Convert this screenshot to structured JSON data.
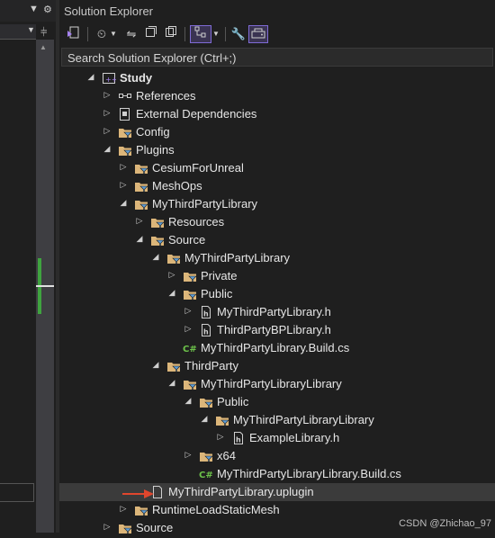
{
  "window_title": "Solution Explorer",
  "search_placeholder": "Search Solution Explorer (Ctrl+;)",
  "watermark": "CSDN @Zhichao_97",
  "tree": [
    {
      "label": "Study",
      "depth": 0,
      "exp": "open",
      "icon": "project",
      "bold": true
    },
    {
      "label": "References",
      "depth": 1,
      "exp": "closed",
      "icon": "references"
    },
    {
      "label": "External Dependencies",
      "depth": 1,
      "exp": "closed",
      "icon": "ext-deps"
    },
    {
      "label": "Config",
      "depth": 1,
      "exp": "closed",
      "icon": "filter-folder"
    },
    {
      "label": "Plugins",
      "depth": 1,
      "exp": "open",
      "icon": "filter-folder"
    },
    {
      "label": "CesiumForUnreal",
      "depth": 2,
      "exp": "closed",
      "icon": "filter-folder"
    },
    {
      "label": "MeshOps",
      "depth": 2,
      "exp": "closed",
      "icon": "filter-folder"
    },
    {
      "label": "MyThirdPartyLibrary",
      "depth": 2,
      "exp": "open",
      "icon": "filter-folder"
    },
    {
      "label": "Resources",
      "depth": 3,
      "exp": "closed",
      "icon": "filter-folder"
    },
    {
      "label": "Source",
      "depth": 3,
      "exp": "open",
      "icon": "filter-folder"
    },
    {
      "label": "MyThirdPartyLibrary",
      "depth": 4,
      "exp": "open",
      "icon": "filter-folder"
    },
    {
      "label": "Private",
      "depth": 5,
      "exp": "closed",
      "icon": "filter-folder"
    },
    {
      "label": "Public",
      "depth": 5,
      "exp": "open",
      "icon": "filter-folder"
    },
    {
      "label": "MyThirdPartyLibrary.h",
      "depth": 6,
      "exp": "closed",
      "icon": "header"
    },
    {
      "label": "ThirdPartyBPLibrary.h",
      "depth": 6,
      "exp": "closed",
      "icon": "header"
    },
    {
      "label": "MyThirdPartyLibrary.Build.cs",
      "depth": 5,
      "exp": "none",
      "icon": "csharp"
    },
    {
      "label": "ThirdParty",
      "depth": 4,
      "exp": "open",
      "icon": "filter-folder"
    },
    {
      "label": "MyThirdPartyLibraryLibrary",
      "depth": 5,
      "exp": "open",
      "icon": "filter-folder"
    },
    {
      "label": "Public",
      "depth": 6,
      "exp": "open",
      "icon": "filter-folder"
    },
    {
      "label": "MyThirdPartyLibraryLibrary",
      "depth": 7,
      "exp": "open",
      "icon": "filter-folder"
    },
    {
      "label": "ExampleLibrary.h",
      "depth": 8,
      "exp": "closed",
      "icon": "header"
    },
    {
      "label": "x64",
      "depth": 6,
      "exp": "closed",
      "icon": "filter-folder"
    },
    {
      "label": "MyThirdPartyLibraryLibrary.Build.cs",
      "depth": 6,
      "exp": "none",
      "icon": "csharp"
    },
    {
      "label": "MyThirdPartyLibrary.uplugin",
      "depth": 3,
      "exp": "none",
      "icon": "file",
      "selected": true
    },
    {
      "label": "RuntimeLoadStaticMesh",
      "depth": 2,
      "exp": "closed",
      "icon": "filter-folder"
    },
    {
      "label": "Source",
      "depth": 1,
      "exp": "closed",
      "icon": "filter-folder"
    }
  ],
  "colors": {
    "folder": "#dcb67a",
    "filter_badge": "#5b9bd5",
    "csharp": "#6cc24a",
    "arrow": "#e0462d"
  }
}
